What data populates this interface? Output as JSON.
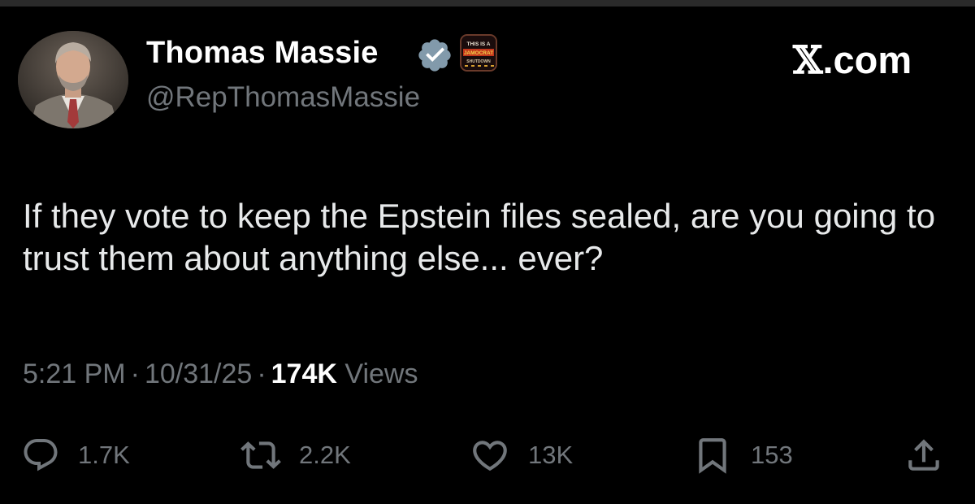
{
  "tweet": {
    "author": {
      "display_name": "Thomas Massie",
      "handle": "@RepThomasMassie",
      "verified": true,
      "badge_text": [
        "THIS IS A",
        "JAMOCRAT",
        "SHUTDOWN"
      ]
    },
    "brand": {
      "x_glyph": "𝕏",
      "suffix": ".com"
    },
    "text": "If they vote to keep the Epstein files sealed, are you going to trust them about anything else... ever?",
    "meta": {
      "time": "5:21 PM",
      "separator": "·",
      "date": "10/31/25",
      "views_count": "174K",
      "views_label": "Views"
    },
    "actions": {
      "replies": "1.7K",
      "reposts": "2.2K",
      "likes": "13K",
      "bookmarks": "153"
    }
  },
  "colors": {
    "background": "#000000",
    "primary_text": "#e7e9ea",
    "secondary_text": "#71767b",
    "verified_badge": "#829aab"
  }
}
